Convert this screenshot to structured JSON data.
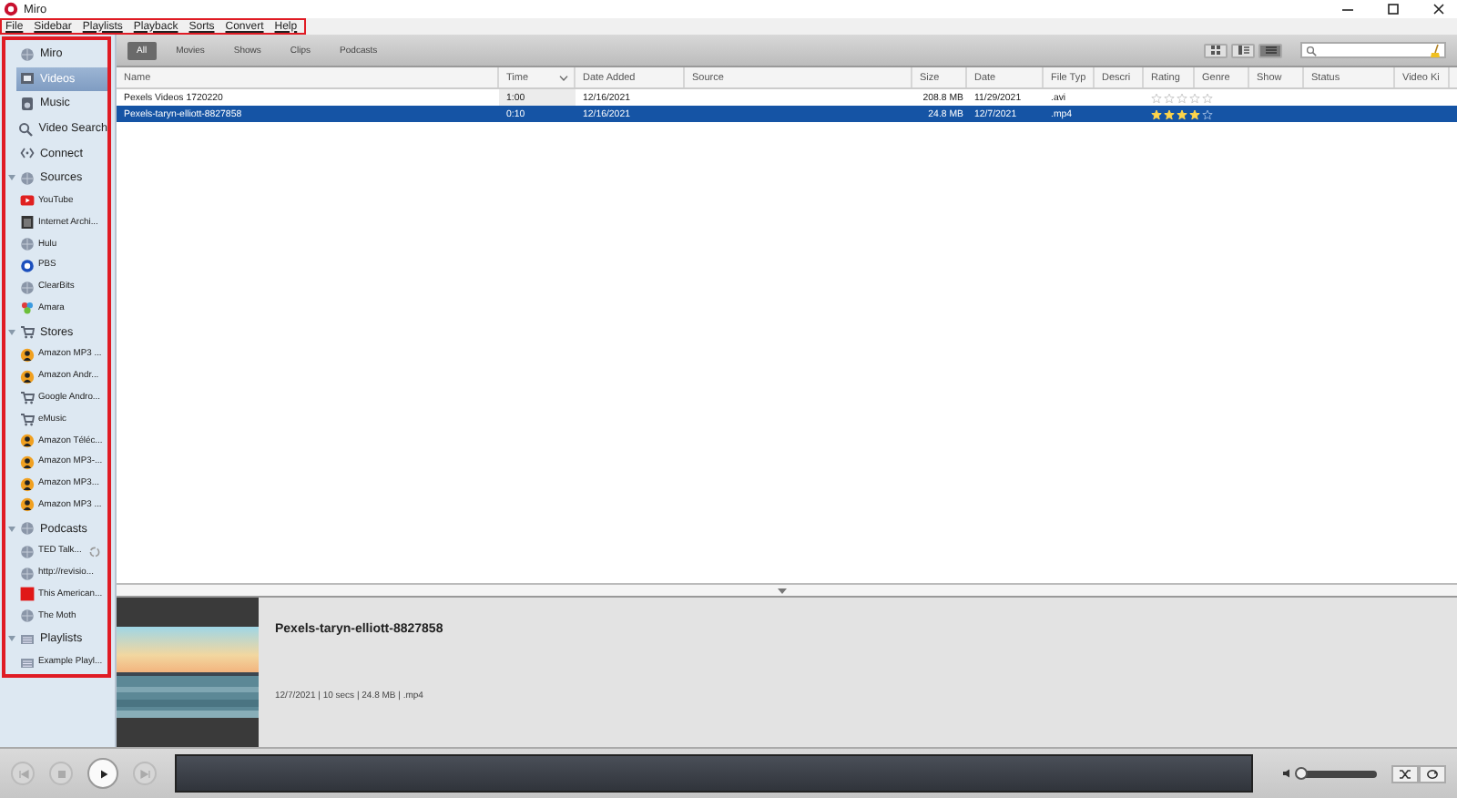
{
  "window": {
    "title": "Miro"
  },
  "menu": {
    "highlighted": true,
    "items": [
      "File",
      "Sidebar",
      "Playlists",
      "Playback",
      "Sorts",
      "Convert",
      "Help"
    ]
  },
  "sidebar": {
    "highlighted": true,
    "items": [
      {
        "label": "Miro",
        "kind": "globe",
        "selected": false
      },
      {
        "label": "Videos",
        "kind": "film",
        "selected": true
      },
      {
        "label": "Music",
        "kind": "speaker",
        "selected": false
      },
      {
        "label": "Video Search",
        "kind": "search",
        "selected": false
      },
      {
        "label": "Connect",
        "kind": "connect",
        "selected": false
      },
      {
        "label": "Sources",
        "kind": "globe",
        "selected": false,
        "expanded": true,
        "children": [
          {
            "label": "YouTube",
            "kind": "play",
            "selected": false
          },
          {
            "label": "Internet Archi...",
            "kind": "box",
            "selected": false
          },
          {
            "label": "Hulu",
            "kind": "globe",
            "selected": false
          },
          {
            "label": "PBS",
            "kind": "ring",
            "selected": false
          },
          {
            "label": "ClearBits",
            "kind": "globe",
            "selected": false
          },
          {
            "label": "Amara",
            "kind": "flower",
            "selected": false
          }
        ]
      },
      {
        "label": "Stores",
        "kind": "cart",
        "selected": false,
        "expanded": true,
        "children": [
          {
            "label": "Amazon MP3 ...",
            "kind": "person",
            "selected": false
          },
          {
            "label": "Amazon Andr...",
            "kind": "person",
            "selected": false
          },
          {
            "label": "Google Andro...",
            "kind": "cart",
            "selected": false
          },
          {
            "label": "eMusic",
            "kind": "cart",
            "selected": false
          },
          {
            "label": "Amazon Téléc...",
            "kind": "person",
            "selected": false
          },
          {
            "label": "Amazon MP3-...",
            "kind": "person",
            "selected": false
          },
          {
            "label": "Amazon MP3...",
            "kind": "person",
            "selected": false
          },
          {
            "label": "Amazon MP3 ...",
            "kind": "person",
            "selected": false
          }
        ]
      },
      {
        "label": "Podcasts",
        "kind": "globe",
        "selected": false,
        "expanded": true,
        "children": [
          {
            "label": "TED Talk...",
            "kind": "globe",
            "selected": false,
            "busy": true
          },
          {
            "label": "http://revisio...",
            "kind": "globe",
            "selected": false,
            "busy": false
          },
          {
            "label": "This American...",
            "kind": "tile",
            "selected": false,
            "busy": false
          },
          {
            "label": "The Moth",
            "kind": "globe",
            "selected": false,
            "busy": false
          }
        ]
      },
      {
        "label": "Playlists",
        "kind": "list",
        "selected": false,
        "expanded": true,
        "children": [
          {
            "label": "Example Playl...",
            "kind": "list",
            "selected": false
          }
        ]
      }
    ]
  },
  "filters": [
    {
      "label": "All",
      "selected": true
    },
    {
      "label": "Movies",
      "selected": false
    },
    {
      "label": "Shows",
      "selected": false
    },
    {
      "label": "Clips",
      "selected": false
    },
    {
      "label": "Podcasts",
      "selected": false
    }
  ],
  "views": [
    {
      "selected": false
    },
    {
      "selected": false
    },
    {
      "selected": true
    }
  ],
  "table": {
    "columns": [
      {
        "label": "Name",
        "sorted": false
      },
      {
        "label": "Time",
        "sorted": true
      },
      {
        "label": "Date Added",
        "sorted": false
      },
      {
        "label": "Source",
        "sorted": false
      },
      {
        "label": "Size",
        "sorted": false
      },
      {
        "label": "Date",
        "sorted": false
      },
      {
        "label": "File Typ",
        "sorted": false
      },
      {
        "label": "Descri",
        "sorted": false
      },
      {
        "label": "Rating",
        "sorted": false
      },
      {
        "label": "Genre",
        "sorted": false
      },
      {
        "label": "Show",
        "sorted": false
      },
      {
        "label": "Status",
        "sorted": false
      },
      {
        "label": "Video Ki",
        "sorted": false
      }
    ],
    "rows": [
      {
        "name": "Pexels Videos 1720220",
        "time": "1:00",
        "date_added": "12/16/2021",
        "size": "208.8 MB",
        "date": "11/29/2021",
        "file_type": ".avi",
        "stars": 0,
        "selected": false
      },
      {
        "name": "Pexels-taryn-elliott-8827858",
        "time": "0:10",
        "date_added": "12/16/2021",
        "size": "24.8 MB",
        "date": "12/7/2021",
        "file_type": ".mp4",
        "stars": 4,
        "selected": true
      }
    ]
  },
  "preview": {
    "kind": "picture",
    "title": "Pexels-taryn-elliott-8827858",
    "details": "12/7/2021 | 10 secs | 24.8 MB | .mp4"
  },
  "player": {
    "volume": {
      "level": 0.05
    }
  }
}
